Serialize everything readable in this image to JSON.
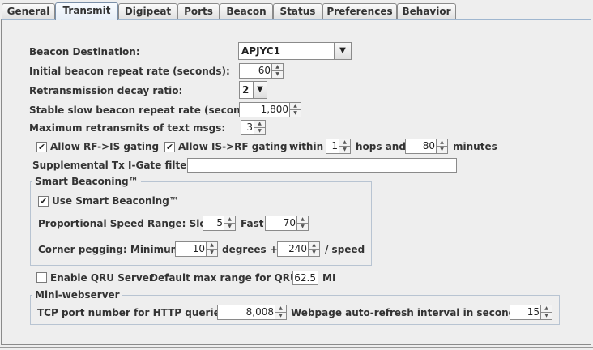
{
  "tabs": [
    {
      "label": "General"
    },
    {
      "label": "Transmit"
    },
    {
      "label": "Digipeat"
    },
    {
      "label": "Ports"
    },
    {
      "label": "Beacon"
    },
    {
      "label": "Status"
    },
    {
      "label": "Preferences"
    },
    {
      "label": "Behavior"
    }
  ],
  "active_tab": "Transmit",
  "form": {
    "beacon_destination": {
      "label": "Beacon Destination:",
      "value": "APJYC1"
    },
    "initial_rate": {
      "label": "Initial beacon repeat rate (seconds):",
      "value": "60"
    },
    "decay_ratio": {
      "label": "Retransmission decay ratio:",
      "value": "2"
    },
    "stable_rate": {
      "label": "Stable slow beacon repeat rate (seconds):",
      "value": "1,800"
    },
    "max_retransmits": {
      "label": "Maximum retransmits of text msgs:",
      "value": "3"
    },
    "allow_rf_is": {
      "label": "Allow RF->IS gating",
      "checked": true
    },
    "allow_is_rf": {
      "label": "Allow IS->RF gating",
      "checked": true
    },
    "within_label": "within",
    "hops_value": "1",
    "hops_label": "hops and",
    "minutes_value": "80",
    "minutes_label": "minutes",
    "tx_filter": {
      "label": "Supplemental Tx I-Gate filter:",
      "value": ""
    }
  },
  "smart_beaconing": {
    "title": "Smart Beaconing™",
    "use": {
      "label": "Use Smart Beaconing™",
      "checked": true
    },
    "speed_label": "Proportional Speed Range: Slow",
    "slow_value": "5",
    "fast_label": "Fast",
    "fast_value": "70",
    "corner_label": "Corner pegging: Minimum",
    "corner_min_value": "10",
    "degrees_label": "degrees +",
    "corner_speed_value": "240",
    "per_speed_label": "/ speed"
  },
  "qru": {
    "enable_label": "Enable QRU Server",
    "enabled": false,
    "range_label": "Default max range for QRU:",
    "range_value": "62.5",
    "unit": "MI"
  },
  "webserver": {
    "title": "Mini-webserver",
    "port_label": "TCP port number for HTTP queries:",
    "port_value": "8,008",
    "refresh_label": "Webpage auto-refresh interval in seconds:",
    "refresh_value": "15"
  },
  "icons": {
    "check": "✔",
    "dropdown": "▼",
    "spin_up": "▲",
    "spin_down": "▼"
  }
}
